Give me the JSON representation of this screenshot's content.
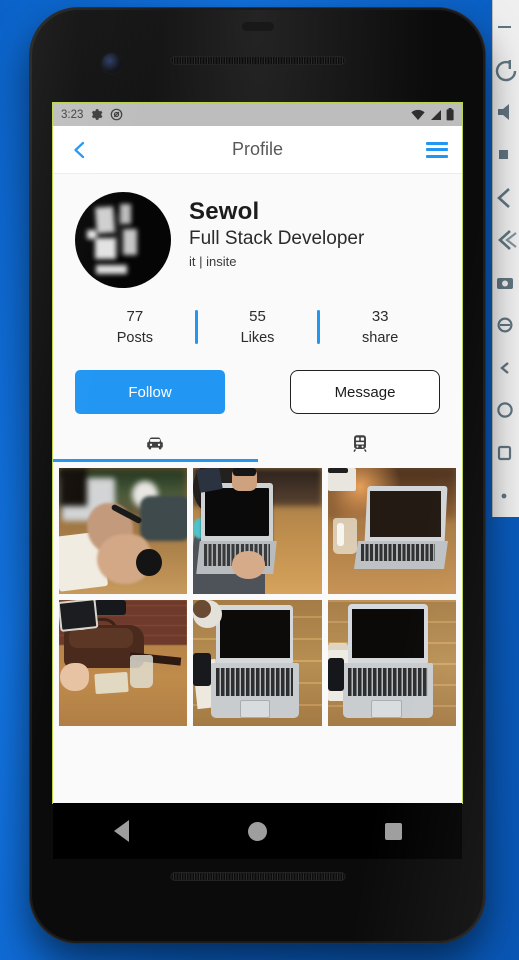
{
  "side_panel": {
    "icons": [
      {
        "name": "minimize-icon"
      },
      {
        "name": "power-icon"
      },
      {
        "name": "volume-up-icon"
      },
      {
        "name": "volume-down-icon"
      },
      {
        "name": "rotate-left-icon"
      },
      {
        "name": "rotate-right-icon"
      },
      {
        "name": "screenshot-icon"
      },
      {
        "name": "zoom-icon"
      },
      {
        "name": "back-icon"
      },
      {
        "name": "home-icon"
      },
      {
        "name": "overview-icon"
      },
      {
        "name": "more-icon"
      }
    ]
  },
  "status_bar": {
    "time": "3:23",
    "left_icons": [
      "gear-icon",
      "sync-icon"
    ],
    "right_icons": [
      "wifi-icon",
      "signal-icon",
      "battery-icon"
    ]
  },
  "app_bar": {
    "title": "Profile",
    "back_icon": "chevron-left-icon",
    "menu_icon": "hamburger-menu-icon"
  },
  "profile": {
    "name": "Sewol",
    "role": "Full Stack Developer",
    "tags": "it | insite"
  },
  "stats": [
    {
      "value": "77",
      "label": "Posts"
    },
    {
      "value": "55",
      "label": "Likes"
    },
    {
      "value": "33",
      "label": "share"
    }
  ],
  "actions": {
    "follow_label": "Follow",
    "message_label": "Message"
  },
  "tabs": [
    {
      "icon": "car-icon",
      "active": true
    },
    {
      "icon": "train-icon",
      "active": false
    }
  ],
  "photo_grid": [
    {
      "caption": "hands-writing-notebook"
    },
    {
      "caption": "person-typing-laptop"
    },
    {
      "caption": "laptop-with-glass"
    },
    {
      "caption": "desk-bag-coffee"
    },
    {
      "caption": "laptop-overhead-wood"
    },
    {
      "caption": "laptop-with-notebook"
    }
  ],
  "nav_bar": {
    "back": "back-triangle-icon",
    "home": "home-circle-icon",
    "recents": "recents-square-icon"
  },
  "colors": {
    "accent": "#2196f3",
    "status_bar_bg": "#bdbdbd",
    "screen_bg": "#fafafa",
    "desktop_bg": "#1273e0"
  }
}
